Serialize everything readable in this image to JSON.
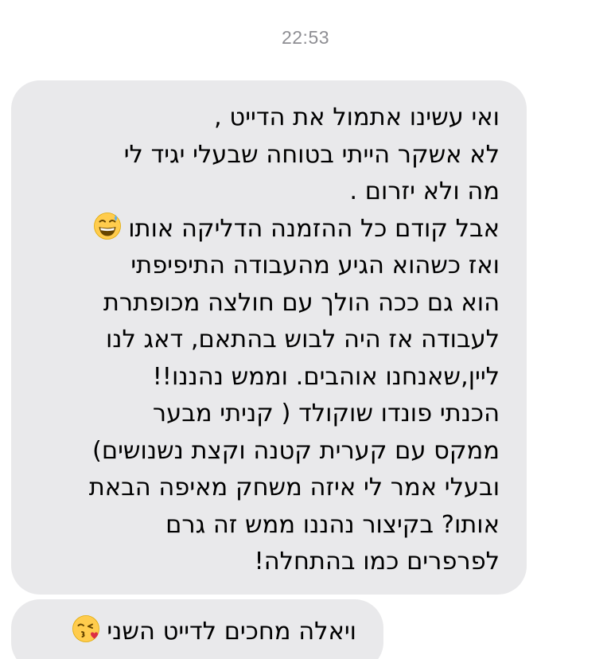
{
  "conversation": {
    "timestamp": "22:53"
  },
  "messages": [
    {
      "lines": [
        "ואי עשינו אתמול את הדייט ,",
        "לא אשקר הייתי בטוחה שבעלי יגיד לי",
        "מה ולא יזרום .",
        "אבל קודם כל ההזמנה הדליקה אותו",
        "ואז כשהוא הגיע מהעבודה התיפיפתי",
        "הוא גם ככה הולך עם חולצה מכופתרת",
        "לעבודה אז היה לבוש בהתאם, דאג לנו",
        "ליין,שאנחנו אוהבים. וממש נהננו!!",
        "הכנתי פונדו שוקולד ( קניתי מבער",
        "ממקס עם קערית קטנה וקצת נשנושים)",
        "ובעלי אמר לי איזה משחק מאיפה הבאת",
        "אותו? בקיצור נהננו ממש זה גרם",
        "לפרפרים כמו בהתחלה!"
      ],
      "emoji": "grinning-face-with-sweat-icon"
    },
    {
      "lines": [
        "ויאלה מחכים לדייט השני"
      ],
      "emoji": "face-blowing-kiss-icon"
    }
  ],
  "colors": {
    "bubble_background": "#e9e9eb",
    "text": "#000000",
    "timestamp": "#8e8e93",
    "page_background": "#ffffff"
  }
}
